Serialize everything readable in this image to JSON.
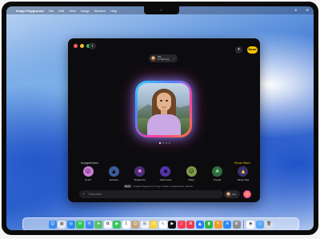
{
  "menubar": {
    "app_name": "Image Playground",
    "items": [
      "File",
      "Edit",
      "View",
      "Image",
      "Window",
      "Help"
    ]
  },
  "header": {
    "person_name": "Lily",
    "person_caption": "Lil Painting",
    "done_label": "Done"
  },
  "canvas": {
    "page_count": 4,
    "current_page": 1
  },
  "suggestions": {
    "label": "Suggestions",
    "show_more": "Show More",
    "items": [
      {
        "label": "Scarf",
        "icon": "scarf-icon",
        "color": "#c97bd8"
      },
      {
        "label": "Volcano",
        "icon": "volcano-icon",
        "color": "#3b5c98"
      },
      {
        "label": "Fireworks",
        "icon": "fireworks-icon",
        "color": "#4d2d79"
      },
      {
        "label": "Astronaut",
        "icon": "astronaut-icon",
        "color": "#5634a8"
      },
      {
        "label": "Hiker",
        "icon": "hiker-icon",
        "color": "#7e9a4a"
      },
      {
        "label": "Forest",
        "icon": "forest-icon",
        "color": "#2f6b3f"
      },
      {
        "label": "Party Hat",
        "icon": "party-hat-icon",
        "color": "#3a2f6a"
      }
    ]
  },
  "prompt": {
    "placeholder": "Describe",
    "person_label": "Lily"
  },
  "disclaimer": {
    "badge": "Beta",
    "text": "Image Playground may create unexpected results."
  },
  "colors": {
    "accent": "#f5c400",
    "window_bg": "#0c0c0f"
  },
  "dock": [
    {
      "name": "finder-icon",
      "color": "#3d8bf0",
      "glyph": "☺"
    },
    {
      "name": "launchpad-icon",
      "color": "#e7e7ef",
      "glyph": "▦"
    },
    {
      "name": "safari-icon",
      "color": "#2b8af2",
      "glyph": "◎"
    },
    {
      "name": "messages-icon",
      "color": "#32c85a",
      "glyph": "✉"
    },
    {
      "name": "mail-icon",
      "color": "#3b8cf2",
      "glyph": "✉"
    },
    {
      "name": "maps-icon",
      "color": "#5cc26a",
      "glyph": "➤"
    },
    {
      "name": "photos-icon",
      "color": "#f7f7f7",
      "glyph": "✿"
    },
    {
      "name": "facetime-icon",
      "color": "#34c759",
      "glyph": "▶"
    },
    {
      "name": "calendar-icon",
      "color": "#ffffff",
      "glyph": "1"
    },
    {
      "name": "contacts-icon",
      "color": "#c7a27a",
      "glyph": "☺"
    },
    {
      "name": "reminders-icon",
      "color": "#f2f2f2",
      "glyph": "☰"
    },
    {
      "name": "notes-icon",
      "color": "#f5d443",
      "glyph": "≡"
    },
    {
      "name": "freeform-icon",
      "color": "#ffffff",
      "glyph": "∿"
    },
    {
      "name": "tv-icon",
      "color": "#111111",
      "glyph": "▶"
    },
    {
      "name": "music-icon",
      "color": "#fa3c54",
      "glyph": "♪"
    },
    {
      "name": "news-icon",
      "color": "#f0384e",
      "glyph": "N"
    },
    {
      "name": "keynote-icon",
      "color": "#2e7cf6",
      "glyph": "▲"
    },
    {
      "name": "numbers-icon",
      "color": "#2fb54a",
      "glyph": "▮"
    },
    {
      "name": "pages-icon",
      "color": "#f29a2e",
      "glyph": "✎"
    },
    {
      "name": "app-store-icon",
      "color": "#2a8af7",
      "glyph": "A"
    },
    {
      "name": "settings-icon",
      "color": "#8e8e93",
      "glyph": "⚙"
    },
    {
      "name": "sep",
      "color": "",
      "glyph": ""
    },
    {
      "name": "image-playground-icon",
      "color": "#ffffff",
      "glyph": "◉"
    },
    {
      "name": "downloads-folder-icon",
      "color": "#5aa6f3",
      "glyph": "▭"
    },
    {
      "name": "trash-icon",
      "color": "#d9dde3",
      "glyph": "🗑"
    }
  ]
}
